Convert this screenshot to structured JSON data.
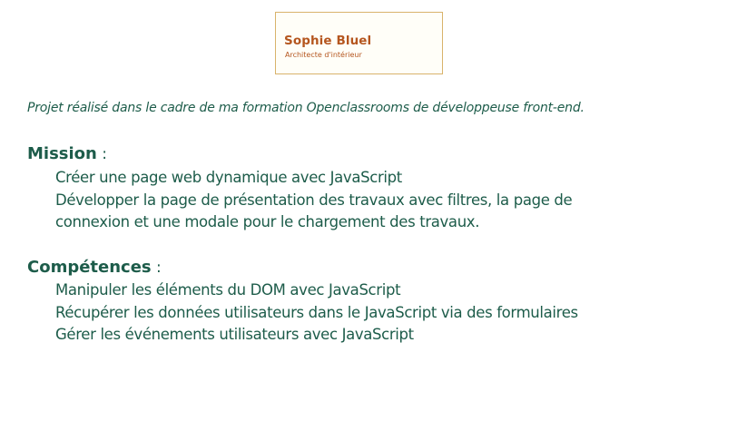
{
  "logo": {
    "name": "Sophie Bluel",
    "subtitle": "Architecte d'intérieur",
    "colors": {
      "text": "#b5561f",
      "border": "#d9b36b"
    }
  },
  "intro": "Projet réalisé dans le cadre de ma formation Openclassrooms de développeuse front-end.",
  "mission": {
    "title": "Mission",
    "colon": " :",
    "lines": [
      "Créer une page web dynamique avec JavaScript",
      "Développer la page de présentation des travaux avec filtres, la page de",
      "connexion et une modale pour le chargement des travaux."
    ]
  },
  "skills": {
    "title": "Compétences",
    "colon": " :",
    "lines": [
      "Manipuler les éléments du DOM avec JavaScript",
      "Récupérer les données utilisateurs dans le JavaScript via des formulaires",
      "Gérer les événements utilisateurs avec JavaScript"
    ]
  },
  "colors": {
    "text": "#1d5c4a",
    "background": "#ffffff"
  }
}
